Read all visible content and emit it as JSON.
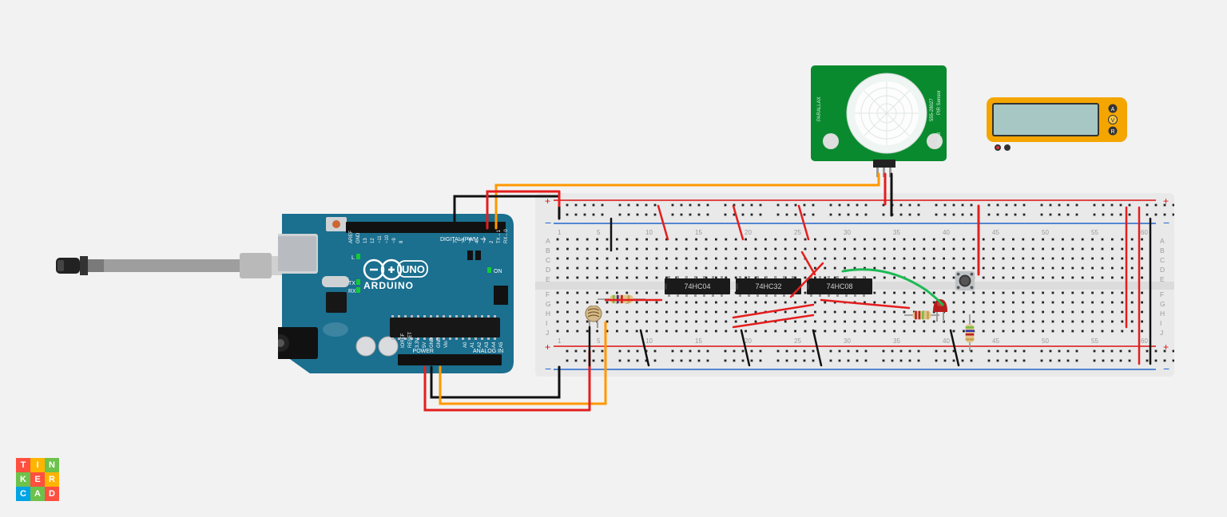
{
  "board": {
    "brand": "ARDUINO",
    "model": "UNO",
    "txLabel": "TX",
    "rxLabel": "RX",
    "lLabel": "L",
    "onLabel": "ON",
    "digitalHeader": "DIGITAL (PWM ~)",
    "analogHeader": "ANALOG IN",
    "powerHeader": "POWER",
    "digitalPins": [
      "AREF",
      "GND",
      "13",
      "12",
      "~11",
      "~10",
      "~9",
      "8",
      "7",
      "~6",
      "~5",
      "4",
      "~3",
      "2",
      "TX→1",
      "RX←0"
    ],
    "powerPins": [
      "IOREF",
      "RESET",
      "3.3V",
      "5V",
      "GND",
      "GND",
      "Vin"
    ],
    "analogPins": [
      "A0",
      "A1",
      "A2",
      "A3",
      "A4",
      "A5"
    ]
  },
  "ics": {
    "ic1": "74HC04",
    "ic2": "74HC32",
    "ic3": "74HC08"
  },
  "pir": {
    "brand": "PARALLAX",
    "partno": "555-28027",
    "title": "PIR Sensor",
    "rev": "Rev B"
  },
  "breadboard": {
    "topNums": [
      "1",
      "5",
      "10",
      "15",
      "20",
      "25",
      "30",
      "35",
      "40",
      "45",
      "50",
      "55",
      "60"
    ],
    "botNums": [
      "1",
      "5",
      "10",
      "15",
      "20",
      "25",
      "30",
      "35",
      "40",
      "45",
      "50",
      "55",
      "60"
    ],
    "rowsTop": [
      "A",
      "B",
      "C",
      "D",
      "E"
    ],
    "rowsBot": [
      "F",
      "G",
      "H",
      "I",
      "J"
    ]
  },
  "multimeter": {
    "modes": [
      "A",
      "V",
      "R"
    ]
  },
  "logo": {
    "letters": [
      "T",
      "I",
      "N",
      "K",
      "E",
      "R",
      "C",
      "A",
      "D"
    ],
    "colors": [
      "#ff4f3f",
      "#ffb400",
      "#6cc24a",
      "#6cc24a",
      "#ff4f3f",
      "#ffb400",
      "#00a4e4",
      "#6cc24a",
      "#ff4f3f"
    ]
  }
}
